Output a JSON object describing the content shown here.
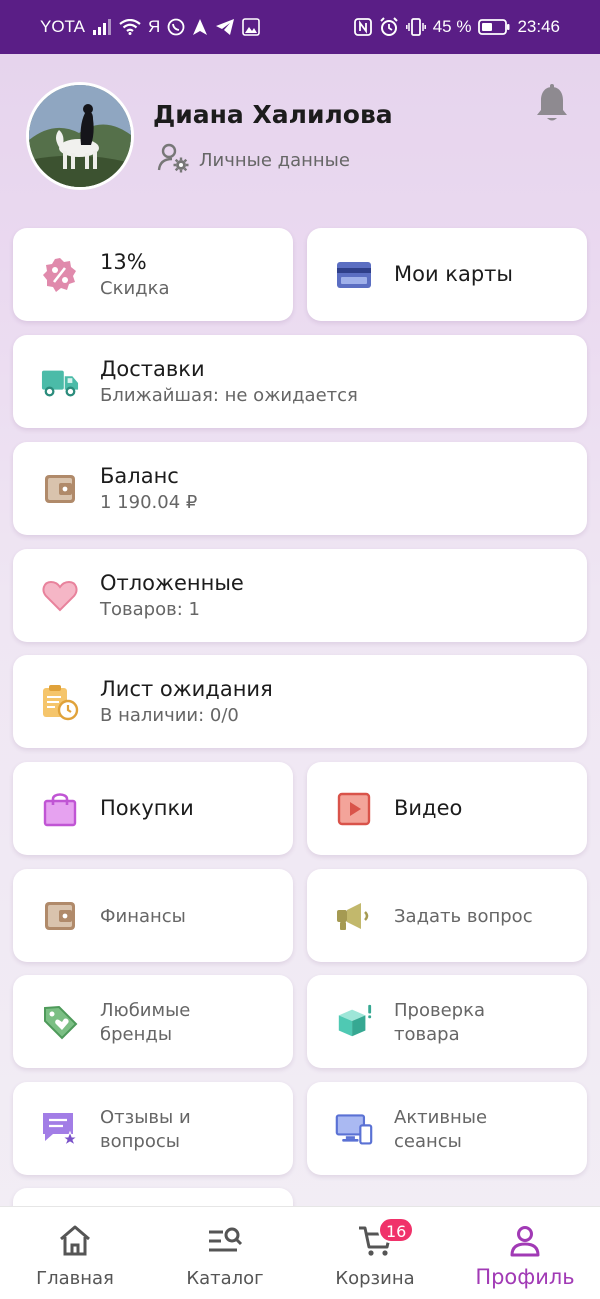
{
  "status_bar": {
    "carrier": "YOTA",
    "ya": "Я",
    "battery": "45 %",
    "time": "23:46"
  },
  "profile": {
    "name": "Диана Халилова",
    "personal_data_label": "Личные данные"
  },
  "cards": {
    "discount": {
      "value": "13%",
      "label": "Скидка"
    },
    "my_cards": {
      "label": "Мои карты"
    },
    "deliveries": {
      "title": "Доставки",
      "subtitle": "Ближайшая: не ожидается"
    },
    "balance": {
      "title": "Баланс",
      "subtitle": "1 190.04 ₽"
    },
    "saved": {
      "title": "Отложенные",
      "subtitle": "Товаров: 1"
    },
    "waitlist": {
      "title": "Лист ожидания",
      "subtitle": "В наличии: 0/0"
    },
    "purchases": {
      "label": "Покупки"
    },
    "video": {
      "label": "Видео"
    },
    "finance": {
      "label": "Финансы"
    },
    "ask_question": {
      "label": "Задать вопрос"
    },
    "fav_brands": {
      "line1": "Любимые",
      "line2": "бренды"
    },
    "check_product": {
      "line1": "Проверка",
      "line2": "товара"
    },
    "reviews": {
      "line1": "Отзывы и",
      "line2": "вопросы"
    },
    "sessions": {
      "line1": "Активные",
      "line2": "сеансы"
    }
  },
  "nav": {
    "home": "Главная",
    "catalog": "Каталог",
    "cart": "Корзина",
    "cart_badge": "16",
    "profile": "Профиль"
  },
  "colors": {
    "status_bar": "#5a1e86",
    "accent": "#a13ab5",
    "badge": "#f0326a"
  },
  "icons": {
    "discount": "percent-badge-icon",
    "my_cards": "credit-card-icon",
    "deliveries": "truck-icon",
    "balance": "wallet-icon",
    "saved": "heart-icon",
    "waitlist": "clipboard-clock-icon",
    "purchases": "shopping-bag-icon",
    "video": "video-play-icon",
    "finance": "wallet-icon",
    "ask_question": "megaphone-icon",
    "fav_brands": "tag-heart-icon",
    "check_product": "box-check-icon",
    "reviews": "chat-star-icon",
    "sessions": "devices-icon"
  }
}
